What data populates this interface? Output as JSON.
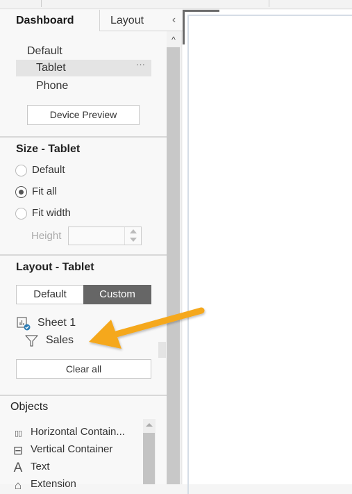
{
  "tabs": {
    "dashboard": "Dashboard",
    "layout": "Layout",
    "collapse_icon": "chevron-left-icon"
  },
  "devices": {
    "items": [
      "Default",
      "Tablet",
      "Phone"
    ],
    "selected": "Tablet",
    "more_glyph": "···",
    "preview_button": "Device Preview"
  },
  "size": {
    "title": "Size - Tablet",
    "options": [
      "Default",
      "Fit all",
      "Fit width"
    ],
    "selected": "Fit all",
    "height_label": "Height",
    "height_value": ""
  },
  "layout": {
    "title": "Layout - Tablet",
    "segments": [
      "Default",
      "Custom"
    ],
    "selected_segment": "Custom",
    "tree": [
      {
        "label": "Sheet 1",
        "icon": "sheet-checked-icon"
      },
      {
        "label": "Sales",
        "icon": "filter-icon"
      }
    ],
    "clear_button": "Clear all"
  },
  "objects": {
    "title": "Objects",
    "items": [
      {
        "label": "Horizontal Contain...",
        "icon": "horizontal-container-icon",
        "glyph": "▯▯"
      },
      {
        "label": "Vertical Container",
        "icon": "vertical-container-icon",
        "glyph": "⊟"
      },
      {
        "label": "Text",
        "icon": "text-icon",
        "glyph": "A"
      },
      {
        "label": "Extension",
        "icon": "extension-icon",
        "glyph": "⌂"
      }
    ]
  },
  "annotation": {
    "arrow_color": "#f5a81c",
    "points_to": "Sales"
  },
  "colors": {
    "segment_active_bg": "#666666",
    "check_badge": "#2e7db5"
  }
}
